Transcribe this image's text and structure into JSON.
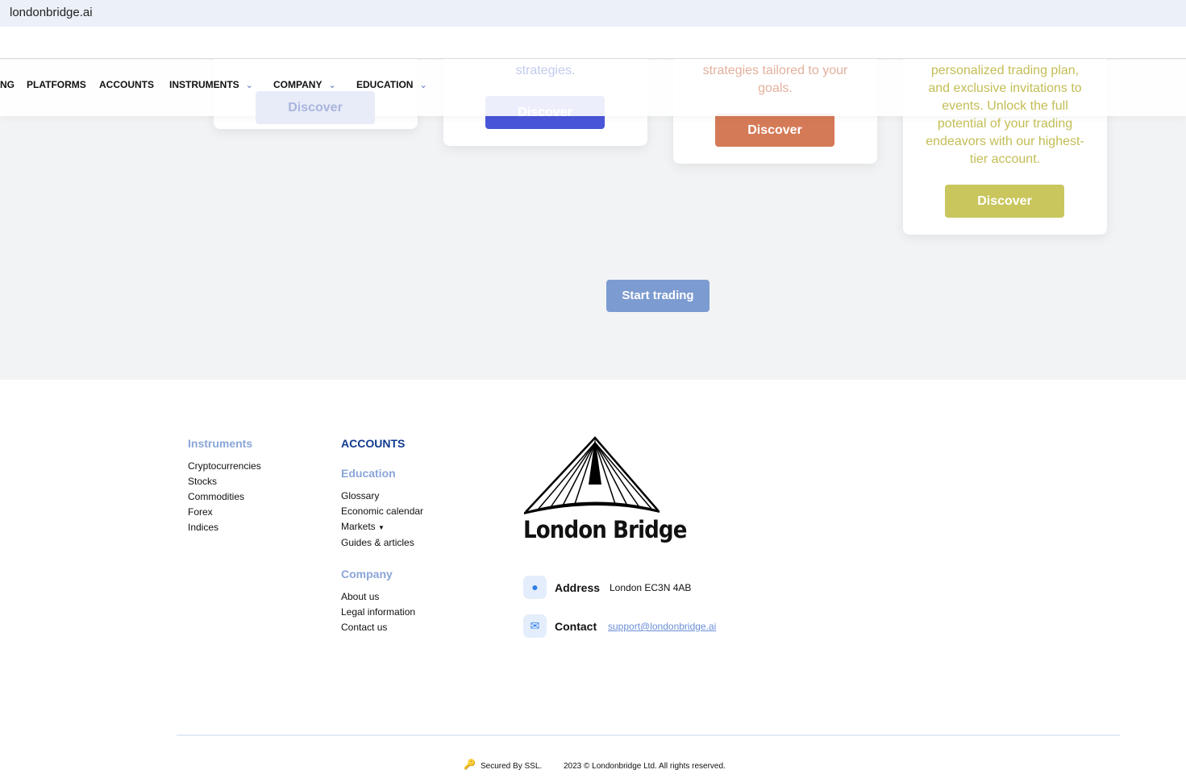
{
  "browser": {
    "url": "londonbridge.ai"
  },
  "nav": {
    "items": [
      {
        "label": "NG"
      },
      {
        "label": "PLATFORMS"
      },
      {
        "label": "ACCOUNTS"
      },
      {
        "label": "INSTRUMENTS"
      },
      {
        "label": "COMPANY"
      },
      {
        "label": "EDUCATION"
      }
    ]
  },
  "cards": [
    {
      "text": "",
      "button": "Discover",
      "color": "#e8ecf8"
    },
    {
      "text": "strategies.",
      "button": "Discover",
      "color": "#4a56d8"
    },
    {
      "text": "strategies tailored to your goals.",
      "button": "Discover",
      "color": "#d57a57"
    },
    {
      "text": "personalized trading plan, and exclusive invitations to events. Unlock the full potential of your trading endeavors with our highest-tier account.",
      "button": "Discover",
      "color": "#c9c65e"
    }
  ],
  "hero": {
    "start_trading": "Start trading"
  },
  "footer": {
    "instruments": {
      "title": "Instruments",
      "links": [
        "Cryptocurrencies",
        "Stocks",
        "Commodities",
        "Forex",
        "Indices"
      ]
    },
    "accounts": {
      "title": "ACCOUNTS"
    },
    "education": {
      "title": "Education",
      "links": [
        "Glossary",
        "Economic calendar",
        "Markets",
        "Guides & articles"
      ]
    },
    "company": {
      "title": "Company",
      "links": [
        "About us",
        "Legal information",
        "Contact us"
      ]
    },
    "logo_text": "London Bridge",
    "address_label": "Address",
    "address": "London EC3N 4AB",
    "contact_label": "Contact",
    "email": "support@londonbridge.ai",
    "ssl": "Secured By SSL.",
    "copyright": "2023 © Londonbridge Ltd. All rights reserved."
  }
}
